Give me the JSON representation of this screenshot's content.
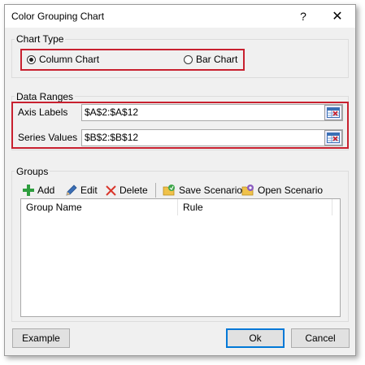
{
  "window": {
    "title": "Color Grouping Chart",
    "help_label": "?",
    "close_label": "✕"
  },
  "chart_type": {
    "group_label": "Chart Type",
    "options": [
      {
        "label": "Column Chart",
        "selected": true
      },
      {
        "label": "Bar Chart",
        "selected": false
      }
    ]
  },
  "data_ranges": {
    "group_label": "Data Ranges",
    "axis_labels": {
      "label": "Axis Labels",
      "value": "$A$2:$A$12"
    },
    "series_values": {
      "label": "Series Values",
      "value": "$B$2:$B$12"
    }
  },
  "groups": {
    "group_label": "Groups",
    "toolbar": {
      "add": "Add",
      "edit": "Edit",
      "delete": "Delete",
      "save_scenario": "Save Scenario",
      "open_scenario": "Open Scenario"
    },
    "columns": [
      "Group Name",
      "Rule"
    ]
  },
  "footer": {
    "example": "Example",
    "ok": "Ok",
    "cancel": "Cancel"
  },
  "colors": {
    "highlight_border": "#c8202f",
    "add_icon": "#2e9e3e",
    "delete_icon": "#d9362b",
    "default_button_border": "#0078d7"
  }
}
